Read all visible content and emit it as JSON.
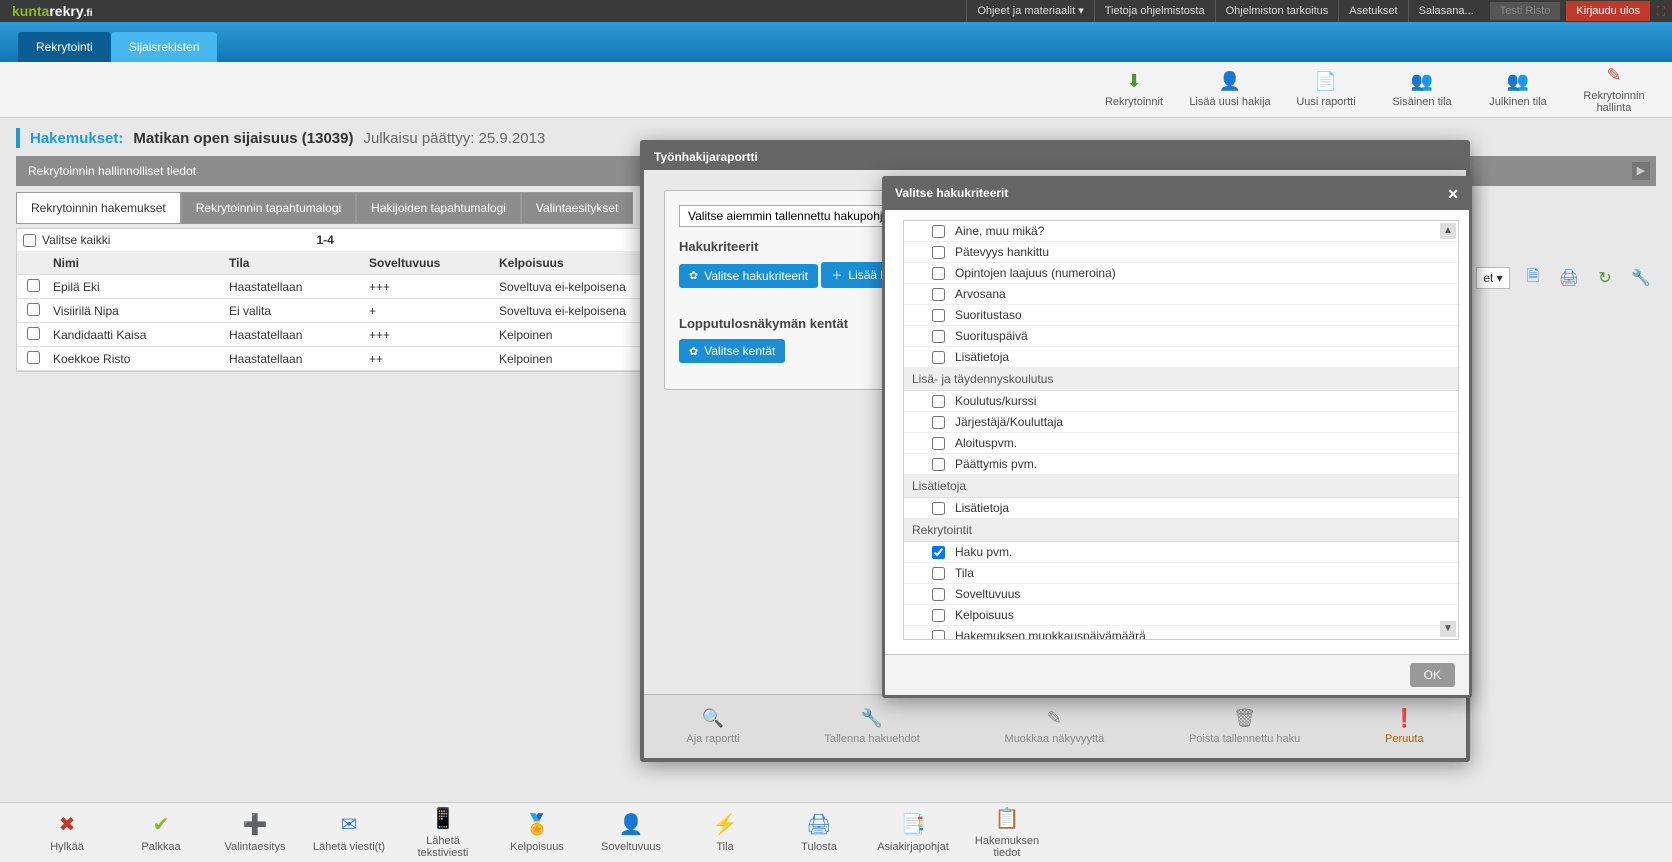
{
  "top": {
    "logo1": "kunta",
    "logo2": "rekry",
    "logo3": ".fi",
    "menu": [
      "Ohjeet ja materiaalit ▾",
      "Tietoja ohjelmistosta",
      "Ohjelmiston tarkoitus",
      "Asetukset",
      "Salasana..."
    ],
    "user": "Testi Risto",
    "logout": "Kirjaudu ulos"
  },
  "tabs": {
    "t1": "Rekrytointi",
    "t2": "Sijaisrekisteri"
  },
  "actions": {
    "a1": "Rekrytoinnit",
    "a2": "Lisää uusi hakija",
    "a3": "Uusi raportti",
    "a4": "Sisäinen tila",
    "a5": "Julkinen tila",
    "a6": "Rekrytoinnin hallinta"
  },
  "breadcrumb": {
    "label": "Hakemukset:",
    "title": "Matikan open sijaisuus (13039)",
    "meta": "Julkaisu päättyy: 25.9.2013"
  },
  "section": "Rekrytoinnin hallinnolliset tiedot",
  "innerTabs": [
    "Rekrytoinnin hakemukset",
    "Rekrytoinnin tapahtumalogi",
    "Hakijoiden tapahtumalogi",
    "Valintaesitykset"
  ],
  "table": {
    "selectAll": "Valitse kaikki",
    "range": "1-4",
    "cols": {
      "nimi": "Nimi",
      "tila": "Tila",
      "sov": "Soveltuvuus",
      "kel": "Kelpoisuus"
    },
    "rows": [
      {
        "nimi": "Epilä Eki",
        "tila": "Haastatellaan",
        "sov": "+++",
        "kel": "Soveltuva ei-kelpoisena"
      },
      {
        "nimi": "Visiirilä Nipa",
        "tila": "Ei valita",
        "sov": "+",
        "kel": "Soveltuva ei-kelpoisena"
      },
      {
        "nimi": "Kandidaatti Kaisa",
        "tila": "Haastatellaan",
        "sov": "+++",
        "kel": "Kelpoinen"
      },
      {
        "nimi": "Koekkoe Risto",
        "tila": "Haastatellaan",
        "sov": "++",
        "kel": "Kelpoinen"
      }
    ]
  },
  "sidetools": {
    "set": "et ▾"
  },
  "modal1": {
    "title": "Työnhakijaraportti",
    "savedLabel": "Valitse aiemmin tallennettu hakupohja",
    "h1": "Hakukriteerit",
    "b1": "Valitse hakukriteerit",
    "b2": "Lisää h",
    "h2": "Lopputulosnäkymän kentät",
    "b3": "Valitse kentät",
    "footer": [
      "Aja raportti",
      "Tallenna hakuehdot",
      "Muokkaa näkyvyyttä",
      "Poista tallennettu haku",
      "Peruuta"
    ]
  },
  "modal2": {
    "title": "Valitse hakukriteerit",
    "ok": "OK",
    "groups": [
      {
        "items": [
          {
            "label": "Aine, muu mikä?",
            "chk": false
          },
          {
            "label": "Pätevyys hankittu",
            "chk": false
          },
          {
            "label": "Opintojen laajuus (numeroina)",
            "chk": false
          },
          {
            "label": "Arvosana",
            "chk": false
          },
          {
            "label": "Suoritustaso",
            "chk": false
          },
          {
            "label": "Suorituspäivä",
            "chk": false
          },
          {
            "label": "Lisätietoja",
            "chk": false
          }
        ]
      },
      {
        "name": "Lisä- ja täydennyskoulutus",
        "items": [
          {
            "label": "Koulutus/kurssi",
            "chk": false
          },
          {
            "label": "Järjestäjä/Kouluttaja",
            "chk": false
          },
          {
            "label": "Aloituspvm.",
            "chk": false
          },
          {
            "label": "Päättymis pvm.",
            "chk": false
          }
        ]
      },
      {
        "name": "Lisätietoja",
        "items": [
          {
            "label": "Lisätietoja",
            "chk": false
          }
        ]
      },
      {
        "name": "Rekrytointit",
        "items": [
          {
            "label": "Haku pvm.",
            "chk": true
          },
          {
            "label": "Tila",
            "chk": false
          },
          {
            "label": "Soveltuvuus",
            "chk": false
          },
          {
            "label": "Kelpoisuus",
            "chk": false
          },
          {
            "label": "Hakemuksen muokkauspäivämäärä",
            "chk": false
          }
        ]
      }
    ]
  },
  "bottom": [
    "Hylkää",
    "Palkkaa",
    "Valintaesitys",
    "Lähetä viesti(t)",
    "Lähetä tekstiviesti",
    "Kelpoisuus",
    "Soveltuvuus",
    "Tila",
    "Tulosta",
    "Asiakirjapohjat",
    "Hakemuksen tiedot"
  ]
}
